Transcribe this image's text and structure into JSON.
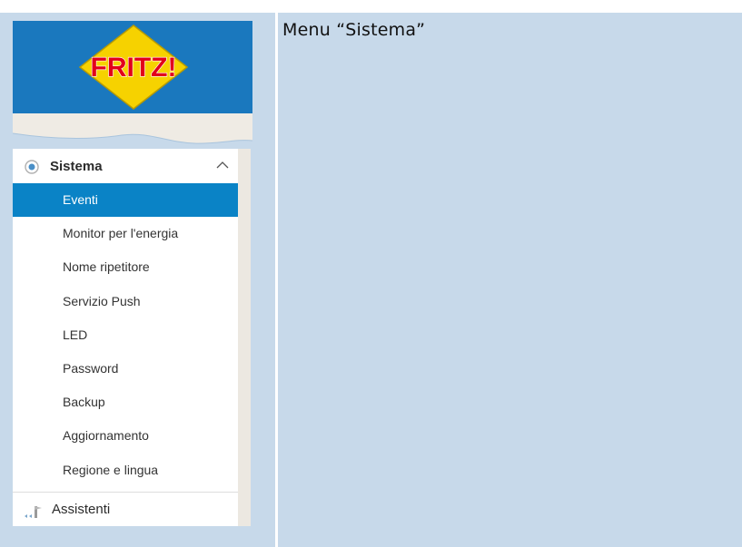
{
  "caption": "Menu “Sistema”",
  "logo": {
    "brand": "FRITZ!"
  },
  "menu": {
    "section": {
      "label": "Sistema",
      "icon": "radio-dot-icon",
      "chevron": "chevron-up-icon"
    },
    "items": [
      {
        "label": "Eventi",
        "active": true
      },
      {
        "label": "Monitor per l'energia"
      },
      {
        "label": "Nome ripetitore"
      },
      {
        "label": "Servizio Push"
      },
      {
        "label": "LED"
      },
      {
        "label": "Password"
      },
      {
        "label": "Backup"
      },
      {
        "label": "Aggiornamento"
      },
      {
        "label": "Regione e lingua"
      }
    ],
    "assistant": {
      "label": "Assistenti",
      "icon": "wizard-icon"
    }
  },
  "colors": {
    "background": "#c7d9ea",
    "logo_blue": "#1a78be",
    "logo_yellow": "#f6d200",
    "logo_red": "#e2001a",
    "active_item": "#0a83c6"
  }
}
